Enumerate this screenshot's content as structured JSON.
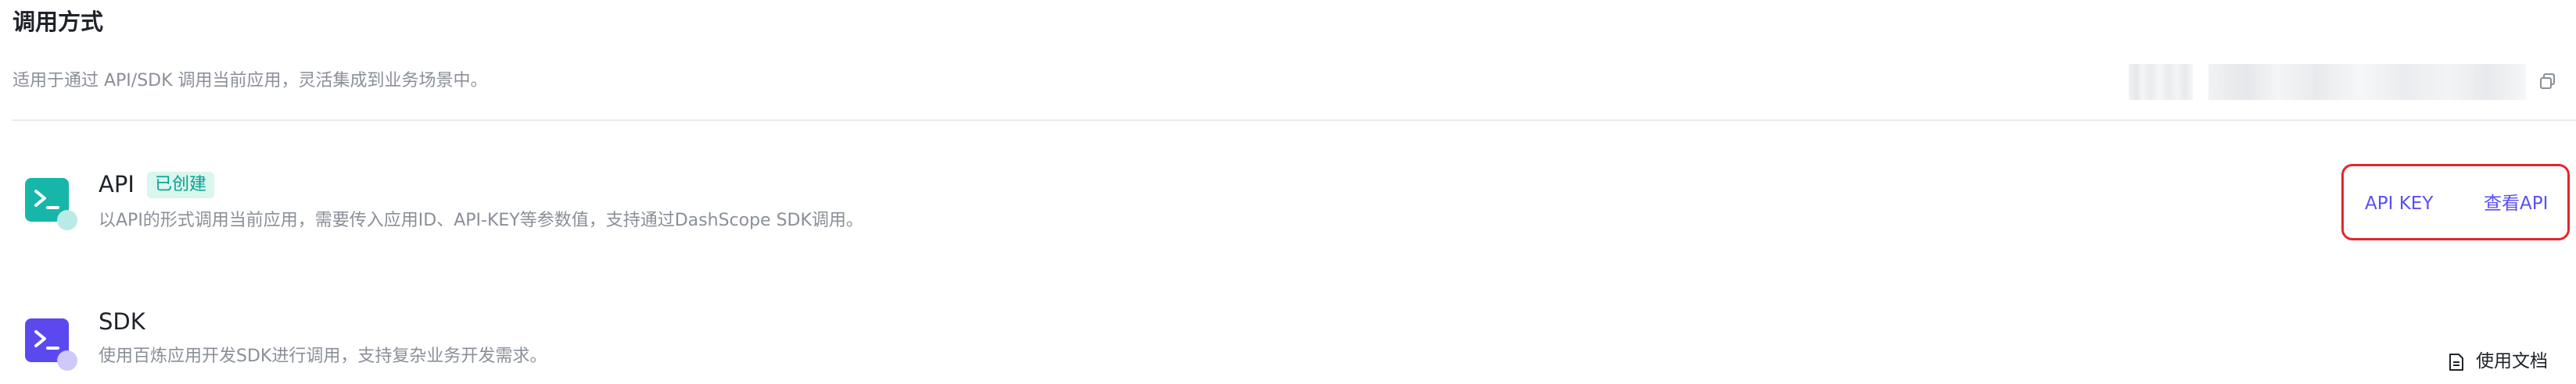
{
  "section": {
    "title": "调用方式",
    "description": "适用于通过 API/SDK 调用当前应用，灵活集成到业务场景中。"
  },
  "app_id": {
    "copy_icon": "copy-icon"
  },
  "items": [
    {
      "name": "API",
      "status": "已创建",
      "description": "以API的形式调用当前应用，需要传入应用ID、API-KEY等参数值，支持通过DashScope SDK调用。",
      "icon": "terminal-icon",
      "icon_color": "#16b7a9",
      "actions": [
        "API KEY",
        "查看API"
      ]
    },
    {
      "name": "SDK",
      "description": "使用百炼应用开发SDK进行调用，支持复杂业务开发需求。",
      "icon": "terminal-icon",
      "icon_color": "#5b49f0",
      "doc_link": "使用文档",
      "doc_icon": "document-icon"
    }
  ],
  "colors": {
    "link": "#5a4ff5",
    "tag_text": "#07a28f",
    "tag_bg": "#d9f6ef",
    "highlight_border": "#e5262b"
  }
}
